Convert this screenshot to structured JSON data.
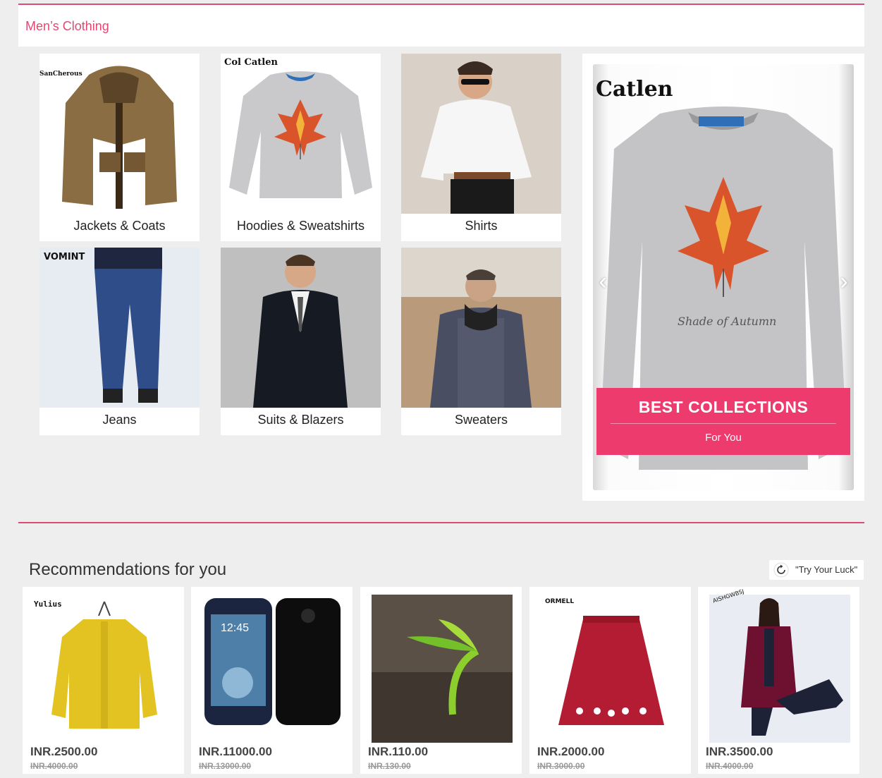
{
  "section": {
    "title": "Men’s Clothing"
  },
  "categories": [
    {
      "label": "Jackets & Coats",
      "brand": "SanCherous"
    },
    {
      "label": "Hoodies & Sweatshirts",
      "brand": "Col Catlen"
    },
    {
      "label": "Shirts"
    },
    {
      "label": "Jeans",
      "brand": "VOMINT"
    },
    {
      "label": "Suits & Blazers"
    },
    {
      "label": "Sweaters"
    }
  ],
  "banner": {
    "brand": "Catlen",
    "headline": "BEST COLLECTIONS",
    "subline": "For You",
    "prev_icon": "chevron-left-icon",
    "next_icon": "chevron-right-icon"
  },
  "recommendations": {
    "title": "Recommendations for you",
    "luck_label": "\"Try Your Luck\"",
    "luck_icon": "refresh-icon",
    "products": [
      {
        "brand": "Yulius",
        "price": "INR.2500.00",
        "old_price": "INR.4000.00"
      },
      {
        "screen_time": "12:45",
        "price": "INR.11000.00",
        "old_price": "INR.13000.00"
      },
      {
        "price": "INR.110.00",
        "old_price": "INR.130.00"
      },
      {
        "brand": "ORMELL",
        "price": "INR.2000.00",
        "old_price": "INR.3000.00"
      },
      {
        "brand": "AISHGWBSJ",
        "price": "INR.3500.00",
        "old_price": "INR.4000.00"
      }
    ]
  },
  "colors": {
    "accent": "#e04a72",
    "cta": "#ec3b6c",
    "background": "#eeeeee"
  }
}
